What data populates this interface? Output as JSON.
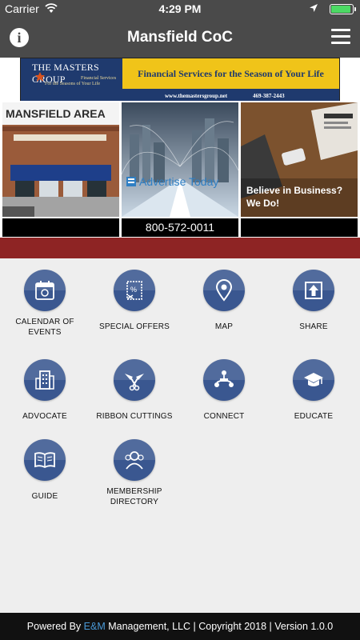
{
  "status_bar": {
    "carrier": "Carrier",
    "time": "4:29 PM"
  },
  "nav": {
    "title": "Mansfield CoC",
    "info_icon": "info-icon",
    "menu_icon": "hamburger-menu-icon"
  },
  "banner": {
    "company": "THE MASTERS GROUP",
    "sub1": "Financial Services",
    "sub2": "For the Seasons of Your Life",
    "tagline": "Financial Services for the Season of Your Life",
    "website": "www.themastersgroup.net",
    "phone": "469-387-2443"
  },
  "tiles": [
    {
      "overlay": "MANSFIELD AREA",
      "caption": ""
    },
    {
      "overlay": "Advertise Today",
      "caption": "800-572-0011"
    },
    {
      "overlay": "Believe in Business? We Do!",
      "caption": ""
    }
  ],
  "menu": {
    "items": [
      {
        "label_line1": "CALENDAR OF",
        "label_line2": "EVENTS",
        "icon": "calendar-icon"
      },
      {
        "label_line1": "SPECIAL OFFERS",
        "icon": "coupon-icon"
      },
      {
        "label_line1": "MAP",
        "icon": "map-pin-icon"
      },
      {
        "label_line1": "SHARE",
        "icon": "share-icon"
      },
      {
        "label_line1": "ADVOCATE",
        "icon": "building-icon"
      },
      {
        "label_line1": "RIBBON CUTTINGS",
        "icon": "ribbon-scissors-icon"
      },
      {
        "label_line1": "CONNECT",
        "icon": "network-icon"
      },
      {
        "label_line1": "EDUCATE",
        "icon": "graduation-cap-icon"
      },
      {
        "label_line1": "GUIDE",
        "icon": "book-icon"
      },
      {
        "label_line1": "MEMBERSHIP",
        "label_line2": "DIRECTORY",
        "icon": "people-icon"
      }
    ]
  },
  "footer": {
    "prefix": "Powered By ",
    "brand": "E&M",
    "suffix": " Management, LLC | Copyright 2018 | Version 1.0.0"
  },
  "colors": {
    "header_bg": "#4a4a4a",
    "red_band": "#8e2424",
    "icon_circle": "#3a5790",
    "footer_bg": "#111111",
    "brand_accent": "#4a9ad8",
    "battery": "#4cd964"
  }
}
